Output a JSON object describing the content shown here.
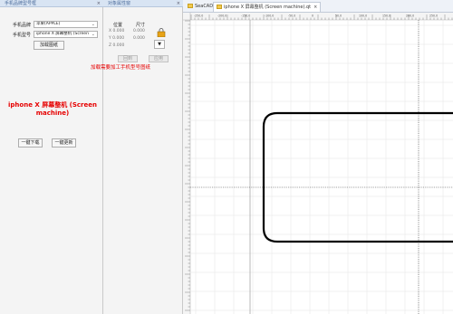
{
  "brand_panel": {
    "title": "手机品牌型号框",
    "close": "×",
    "brand_label": "手机品牌",
    "brand_value": "苹果(APPLE)",
    "model_label": "手机型号",
    "model_value": "iphone X 屏幕整机 (Screen",
    "load_button": "加载图纸",
    "model_title": "iphone X 屏幕整机 (Screen machine)",
    "download_button": "一键下载",
    "update_button": "一键更新"
  },
  "props_panel": {
    "title": "对象属性窗",
    "close": "×",
    "position_header": "位置",
    "size_header": "尺寸",
    "x_row": "X 0.000",
    "y_row": "Y 0.000",
    "z_row": "Z 0.000",
    "size_w": "0.000",
    "size_h": "0.000",
    "reset_button": "回到",
    "apply_button": "应用",
    "dropdown_glyph": "▼",
    "hint": "加载需要加工手机型号图纸"
  },
  "editor": {
    "tabs": [
      {
        "label": "SeaCAD1"
      },
      {
        "label": "iphone X 屏幕整机 (Screen machine).qt",
        "close": "×"
      }
    ],
    "ruler_labels": [
      "-250.0",
      "-200.0",
      "-150.0",
      "-100.0",
      "-50.0",
      "0",
      "50.0",
      "100.0",
      "150.0",
      "200.0",
      "250.0"
    ]
  },
  "colors": {
    "accent_red": "#e60000",
    "panel_bg": "#f4f4f4",
    "title_bar": "#d8e4f3",
    "grid": "#e4e4e4"
  }
}
